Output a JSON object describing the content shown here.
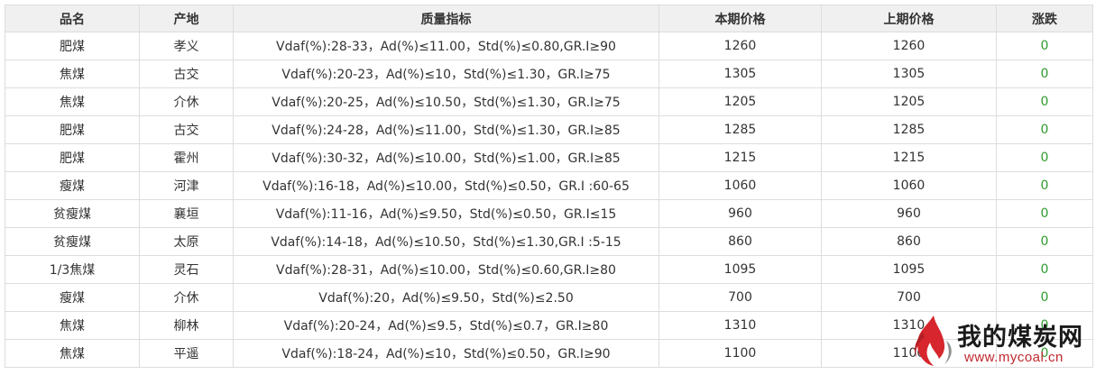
{
  "table": {
    "headers": {
      "name": "品名",
      "origin": "产地",
      "quality": "质量指标",
      "current_price": "本期价格",
      "previous_price": "上期价格",
      "change": "涨跌"
    },
    "rows": [
      {
        "name": "肥煤",
        "origin": "孝义",
        "quality": "Vdaf(%):28-33，Ad(%)≤11.00，Std(%)≤0.80,GR.I≥90",
        "current_price": "1260",
        "previous_price": "1260",
        "change": "0"
      },
      {
        "name": "焦煤",
        "origin": "古交",
        "quality": "Vdaf(%):20-23，Ad(%)≤10，Std(%)≤1.30，GR.I≥75",
        "current_price": "1305",
        "previous_price": "1305",
        "change": "0"
      },
      {
        "name": "焦煤",
        "origin": "介休",
        "quality": "Vdaf(%):20-25，Ad(%)≤10.50，Std(%)≤1.30，GR.I≥75",
        "current_price": "1205",
        "previous_price": "1205",
        "change": "0"
      },
      {
        "name": "肥煤",
        "origin": "古交",
        "quality": "Vdaf(%):24-28，Ad(%)≤11.00，Std(%)≤1.30，GR.I≥85",
        "current_price": "1285",
        "previous_price": "1285",
        "change": "0"
      },
      {
        "name": "肥煤",
        "origin": "霍州",
        "quality": "Vdaf(%):30-32，Ad(%)≤10.00，Std(%)≤1.00，GR.I≥85",
        "current_price": "1215",
        "previous_price": "1215",
        "change": "0"
      },
      {
        "name": "瘦煤",
        "origin": "河津",
        "quality": "Vdaf(%):16-18，Ad(%)≤10.00，Std(%)≤0.50，GR.I :60-65",
        "current_price": "1060",
        "previous_price": "1060",
        "change": "0"
      },
      {
        "name": "贫瘦煤",
        "origin": "襄垣",
        "quality": "Vdaf(%):11-16，Ad(%)≤9.50，Std(%)≤0.50，GR.I≤15",
        "current_price": "960",
        "previous_price": "960",
        "change": "0"
      },
      {
        "name": "贫瘦煤",
        "origin": "太原",
        "quality": "Vdaf(%):14-18，Ad(%)≤10.50，Std(%)≤1.30,GR.I :5-15",
        "current_price": "860",
        "previous_price": "860",
        "change": "0"
      },
      {
        "name": "1/3焦煤",
        "origin": "灵石",
        "quality": "Vdaf(%):28-31，Ad(%)≤10.00，Std(%)≤0.60,GR.I≥80",
        "current_price": "1095",
        "previous_price": "1095",
        "change": "0"
      },
      {
        "name": "瘦煤",
        "origin": "介休",
        "quality": "Vdaf(%):20，Ad(%)≤9.50，Std(%)≤2.50",
        "current_price": "700",
        "previous_price": "700",
        "change": "0"
      },
      {
        "name": "焦煤",
        "origin": "柳林",
        "quality": "Vdaf(%):20-24，Ad(%)≤9.5，Std(%)≤0.7，GR.I≥80",
        "current_price": "1310",
        "previous_price": "1310",
        "change": "0"
      },
      {
        "name": "焦煤",
        "origin": "平遥",
        "quality": "Vdaf(%):18-24，Ad(%)≤10，Std(%)≤0.50，GR.I≥90",
        "current_price": "1100",
        "previous_price": "1100",
        "change": "0"
      }
    ]
  },
  "watermark": {
    "brand_name": "我的煤炭网",
    "url": "www.mycoal.cn",
    "icon": "flame-logo-icon"
  },
  "colors": {
    "header_bg": "#f0f0f0",
    "border": "#dddddd",
    "change_green": "#2e9b2e",
    "brand_red": "#c0282d"
  }
}
